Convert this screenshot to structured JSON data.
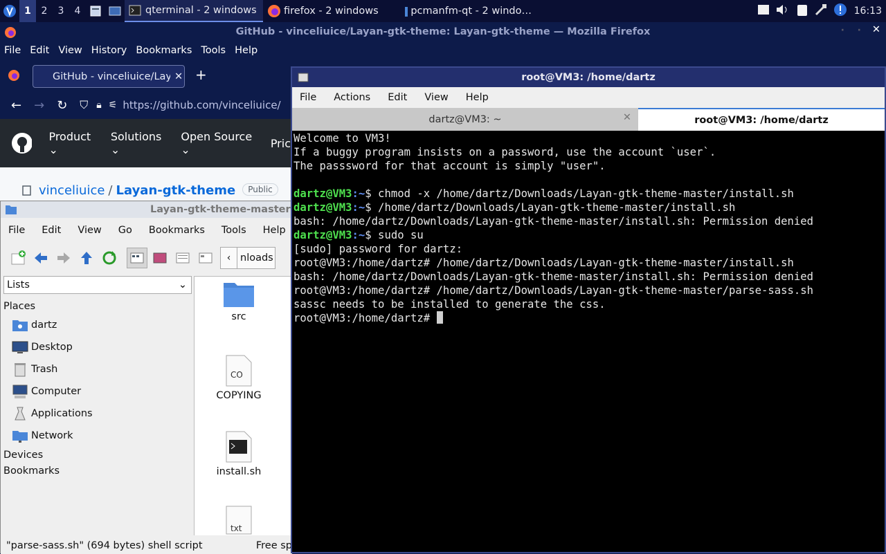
{
  "taskbar": {
    "workspaces": [
      "1",
      "2",
      "3",
      "4"
    ],
    "tasks": [
      {
        "label": "qterminal - 2 windows"
      },
      {
        "label": "firefox - 2 windows"
      },
      {
        "label": "pcmanfm-qt - 2 windo…"
      }
    ],
    "clock": "16:13"
  },
  "firefox": {
    "title": "GitHub - vinceliuice/Layan-gtk-theme: Layan-gtk-theme — Mozilla Firefox",
    "menu": [
      "File",
      "Edit",
      "View",
      "History",
      "Bookmarks",
      "Tools",
      "Help"
    ],
    "tab_label": "GitHub - vinceliuice/Laya",
    "url": "https://github.com/vinceliuice/",
    "gh_nav": [
      "Product",
      "Solutions",
      "Open Source",
      "Pric"
    ],
    "repo_owner": "vinceliuice",
    "repo_sep": "/",
    "repo_name": "Layan-gtk-theme",
    "repo_badge": "Public"
  },
  "filemanager": {
    "title": "Layan-gtk-theme-master",
    "menu": [
      "File",
      "Edit",
      "View",
      "Go",
      "Bookmarks",
      "Tools",
      "Help"
    ],
    "path_fragment": "nloads",
    "view_select": "Lists",
    "places_header": "Places",
    "places": [
      "dartz",
      "Desktop",
      "Trash",
      "Computer",
      "Applications",
      "Network"
    ],
    "devices_header": "Devices",
    "bookmarks_header": "Bookmarks",
    "files": [
      {
        "name": "src",
        "icon": "folder-icon"
      },
      {
        "name": "COPYING",
        "icon": "text-file-icon",
        "tag": "CO"
      },
      {
        "name": "install.sh",
        "icon": "shell-script-icon"
      },
      {
        "name": "",
        "icon": "text-file-icon",
        "tag": "txt"
      }
    ],
    "status": "\"parse-sass.sh\" (694 bytes) shell script",
    "free_space": "Free sp"
  },
  "terminal": {
    "title": "root@VM3: /home/dartz",
    "menu": [
      "File",
      "Actions",
      "Edit",
      "View",
      "Help"
    ],
    "tabs": [
      "dartz@VM3: ~",
      "root@VM3: /home/dartz"
    ],
    "lines": {
      "l1": "Welcome to VM3!",
      "l2": "If a buggy program insists on a password, use the account `user`.",
      "l3": "The passsword for that account is simply \"user\".",
      "u1": "dartz@VM3",
      "c1": "$ chmod -x /home/dartz/Downloads/Layan-gtk-theme-master/install.sh",
      "c2": "$ /home/dartz/Downloads/Layan-gtk-theme-master/install.sh",
      "o2": "bash: /home/dartz/Downloads/Layan-gtk-theme-master/install.sh: Permission denied",
      "c3": "$ sudo su",
      "o3": "[sudo] password for dartz:",
      "r1": "root@VM3:/home/dartz# /home/dartz/Downloads/Layan-gtk-theme-master/install.sh",
      "o4": "bash: /home/dartz/Downloads/Layan-gtk-theme-master/install.sh: Permission denied",
      "r2": "root@VM3:/home/dartz# /home/dartz/Downloads/Layan-gtk-theme-master/parse-sass.sh",
      "o5": "sassc needs to be installed to generate the css.",
      "r3": "root@VM3:/home/dartz# ",
      "path": ":~"
    }
  }
}
